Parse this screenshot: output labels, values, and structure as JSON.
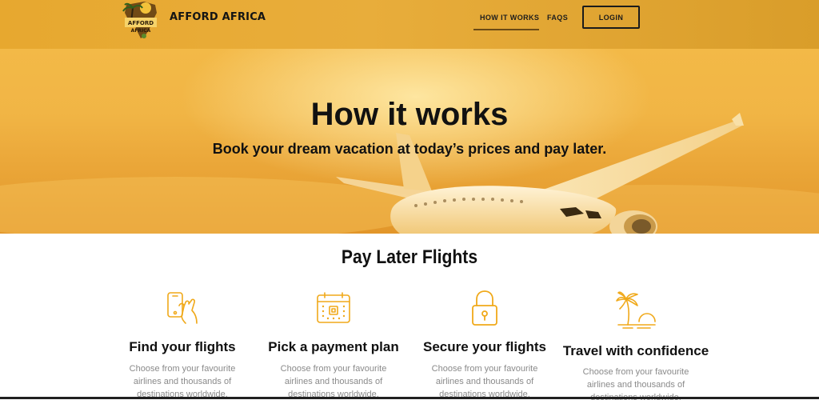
{
  "header": {
    "brand": "AFFORD AFRICA",
    "logo_text": "AFFORD AFRICA",
    "nav": [
      {
        "label": "HOW IT WORKS",
        "active": true
      },
      {
        "label": "FAQS",
        "active": false
      }
    ],
    "login_label": "LOGIN"
  },
  "hero": {
    "title": "How it works",
    "subtitle": "Book your dream vacation at today’s prices and pay later."
  },
  "section": {
    "title": "Pay Later Flights"
  },
  "features": [
    {
      "icon": "phone-touch-icon",
      "title": "Find your flights",
      "desc": "Choose from your favourite airlines and thousands of destinations worldwide."
    },
    {
      "icon": "calendar-icon",
      "title": "Pick a payment plan",
      "desc": "Choose from your favourite airlines and thousands of destinations worldwide."
    },
    {
      "icon": "lock-icon",
      "title": "Secure your flights",
      "desc": "Choose from your favourite airlines and thousands of destinations worldwide."
    },
    {
      "icon": "palm-sunset-icon",
      "title": "Travel with confidence",
      "desc": "Choose from your favourite airlines and thousands of destinations worldwide."
    }
  ],
  "colors": {
    "header_bg": "#e8ad3b",
    "icon_accent": "#f0a91a",
    "text_dark": "#111111",
    "desc_gray": "#8a8a8a"
  }
}
